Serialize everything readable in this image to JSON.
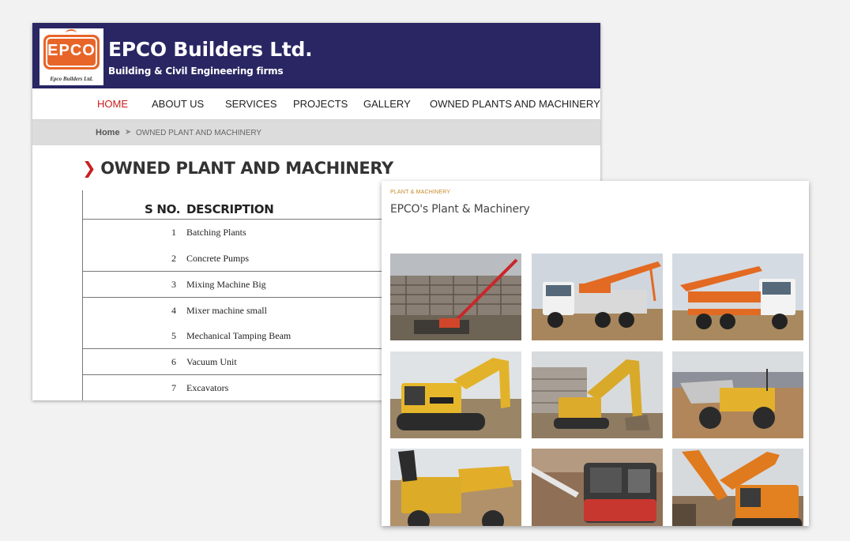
{
  "site": {
    "logo_letters": "EPCO",
    "logo_caption": "Epco Builders Ltd.",
    "title": "EPCO Builders Ltd.",
    "subtitle": "Building & Civil Engineering firms",
    "nav": [
      {
        "label": "HOME",
        "active": true
      },
      {
        "label": "ABOUT US",
        "active": false
      },
      {
        "label": "SERVICES",
        "active": false
      },
      {
        "label": "PROJECTS",
        "active": false
      },
      {
        "label": "GALLERY",
        "active": false
      },
      {
        "label": "OWNED PLANTS AND MACHINERY",
        "active": false
      }
    ],
    "breadcrumb": {
      "home": "Home",
      "separator": "➤",
      "current": "OWNED PLANT AND MACHINERY"
    },
    "heading": "OWNED PLANT AND MACHINERY",
    "table": {
      "headers": [
        "S NO.",
        "DESCRIPTION"
      ],
      "rows": [
        {
          "no": "1",
          "desc": "Batching Plants"
        },
        {
          "no": "2",
          "desc": "Concrete Pumps"
        },
        {
          "no": "3",
          "desc": "Mixing Machine Big"
        },
        {
          "no": "4",
          "desc": "Mixer machine small"
        },
        {
          "no": "5",
          "desc": "Mechanical Tamping Beam"
        },
        {
          "no": "6",
          "desc": "Vacuum Unit"
        },
        {
          "no": "7",
          "desc": "Excavators"
        }
      ]
    }
  },
  "gallery": {
    "tag": "PLANT & MACHINERY",
    "title": "EPCO's Plant & Machinery",
    "photos": [
      {
        "subject": "crane-at-construction-site"
      },
      {
        "subject": "concrete-pump-truck"
      },
      {
        "subject": "concrete-pump-truck"
      },
      {
        "subject": "cat-320dl-excavator"
      },
      {
        "subject": "excavator-at-building"
      },
      {
        "subject": "dumper"
      },
      {
        "subject": "site-dumper"
      },
      {
        "subject": "tamping-machine"
      },
      {
        "subject": "orange-excavator"
      }
    ]
  },
  "colors": {
    "header_bg": "#292663",
    "accent_red": "#c8201e",
    "logo_orange": "#e8652a",
    "tag_gold": "#c8892a"
  }
}
